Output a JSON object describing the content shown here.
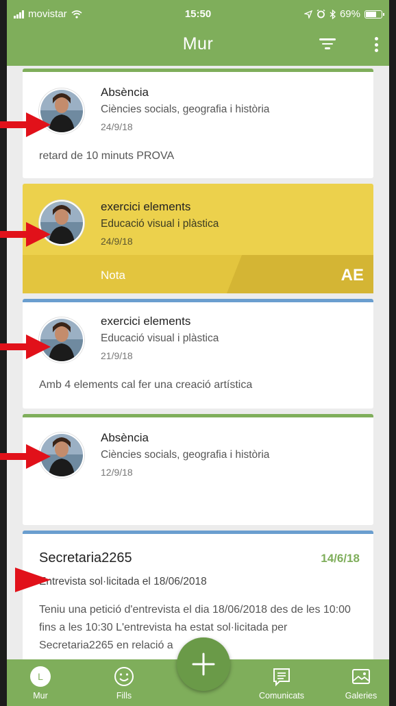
{
  "status": {
    "carrier": "movistar",
    "time": "15:50",
    "battery": "69%"
  },
  "appbar": {
    "title": "Mur"
  },
  "feed": [
    {
      "type": "Absència",
      "subject": "Ciències socials, geografia i història",
      "date": "24/9/18",
      "body": "retard de 10 minuts PROVA"
    },
    {
      "type": "exercici elements",
      "subject": "Educació visual i plàstica",
      "date": "24/9/18",
      "note_label": "Nota",
      "grade": "AE"
    },
    {
      "type": "exercici elements",
      "subject": "Educació visual i plàstica",
      "date": "21/9/18",
      "body": "Amb 4 elements cal fer una creació artística"
    },
    {
      "type": "Absència",
      "subject": "Ciències socials, geografia i història",
      "date": "12/9/18"
    },
    {
      "sender": "Secretaria2265",
      "date": "14/6/18",
      "subtitle": "Entrevista sol·licitada el 18/06/2018",
      "body": "Teniu una petició d'entrevista el dia 18/06/2018 des de les 10:00 fins a les 10:30 L'entrevista ha estat sol·licitada per Secretaria2265 en relació a"
    }
  ],
  "tabs": {
    "mur": "Mur",
    "fills": "Fills",
    "comunicats": "Comunicats",
    "galeries": "Galeries",
    "mur_avatar_letter": "L"
  },
  "colors": {
    "primary": "#7fae5b",
    "accent_blue": "#6a9ecf",
    "note_yellow": "#ecd14c",
    "arrow_red": "#e1111a"
  }
}
